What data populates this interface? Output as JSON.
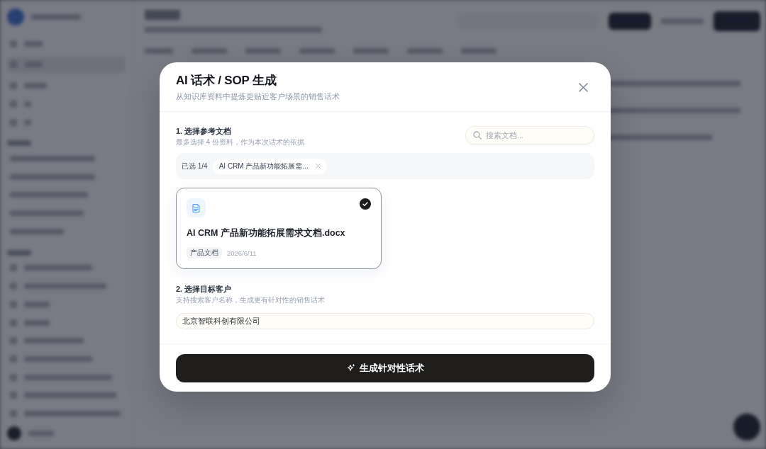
{
  "dialog": {
    "title": "AI 话术 / SOP 生成",
    "subtitle": "从知识库资料中提炼更贴近客户场景的销售话术",
    "documents_section": {
      "heading": "1. 选择参考文档",
      "hint": "最多选择 4 份资料，作为本次话术的依据",
      "search": {
        "placeholder": "搜索文档..."
      },
      "selected_count": "已选 1/4",
      "selected_chips": [
        {
          "label": "AI CRM 产品新功能拓展需..."
        }
      ],
      "documents": [
        {
          "name": "AI CRM 产品新功能拓展需求文档.docx",
          "tag": "产品文档",
          "date": "2026/6/11",
          "selected": true
        }
      ]
    },
    "customer_section": {
      "heading": "2. 选择目标客户",
      "hint": "支持搜索客户名称，生成更有针对性的销售话术",
      "customer_field": {
        "value": "北京智联科创有限公司"
      }
    },
    "generate_button": {
      "label": "生成针对性话术"
    }
  }
}
